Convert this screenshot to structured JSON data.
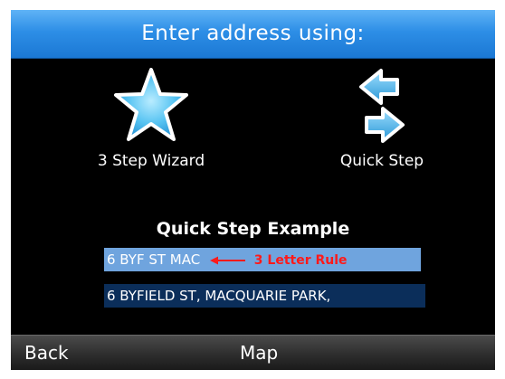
{
  "header": {
    "title": "Enter address using:"
  },
  "options": [
    {
      "label": "3 Step Wizard",
      "icon": "star-icon"
    },
    {
      "label": "Quick Step",
      "icon": "arrows-icon"
    }
  ],
  "example": {
    "title": "Quick Step Example",
    "input_text": "6 BYF ST MAC",
    "rule_label": "3 Letter Rule",
    "result_text": "6 BYFIELD ST, MACQUARIE PARK,"
  },
  "softkeys": {
    "left": "Back",
    "center": "Map"
  },
  "colors": {
    "title_bar": "#2d8ee6",
    "screen_bg": "#000000",
    "highlight_row": "#6fa4de",
    "result_row": "#0b2e5a",
    "rule_text": "#ff1a1a",
    "icon_blue": "#56c3f2"
  }
}
